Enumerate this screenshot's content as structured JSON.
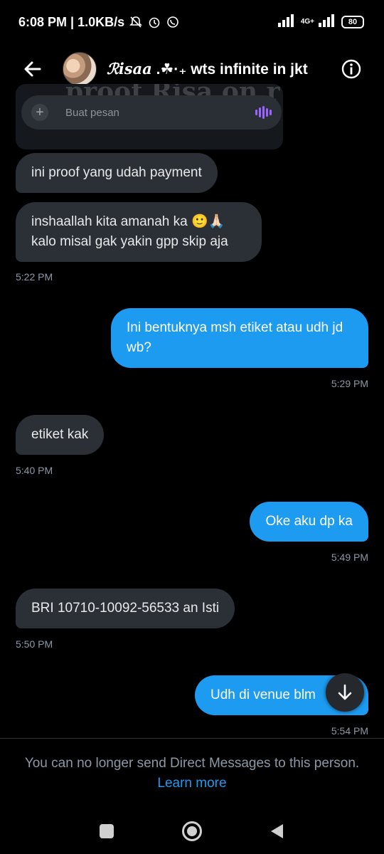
{
  "status_bar": {
    "time_speed": "6:08 PM | 1.0KB/s",
    "network": "4G+",
    "battery": "80"
  },
  "header": {
    "title_script": "ℛisaa",
    "title_rest": " .☘·₊ wts infinite in jkt",
    "back_icon": "arrow-left-icon",
    "info_icon": "info-icon"
  },
  "embed": {
    "overlay_text": "proof Risa on r",
    "composer_placeholder": "Buat pesan"
  },
  "messages": [
    {
      "side": "received",
      "text": "ini proof yang udah payment"
    },
    {
      "side": "received",
      "text": "inshaallah kita amanah ka 🙂🙏🏻 kalo misal gak yakin gpp skip aja",
      "time": "5:22 PM"
    },
    {
      "side": "sent",
      "text": "Ini bentuknya msh etiket atau udh jd wb?",
      "time": "5:29 PM"
    },
    {
      "side": "received",
      "text": "etiket kak",
      "time": "5:40 PM"
    },
    {
      "side": "sent",
      "text": "Oke aku dp ka",
      "time": "5:49 PM"
    },
    {
      "side": "received",
      "text": "BRI 10710-10092-56533 an Isti",
      "time": "5:50 PM"
    },
    {
      "side": "sent",
      "text": "Udh di venue blm",
      "time": "5:54 PM"
    }
  ],
  "footer": {
    "notice": "You can no longer send Direct Messages to this person.",
    "learn_more": "Learn more"
  },
  "colors": {
    "accent": "#1d9bf0",
    "received_bubble": "#2b3036",
    "background": "#000000"
  }
}
